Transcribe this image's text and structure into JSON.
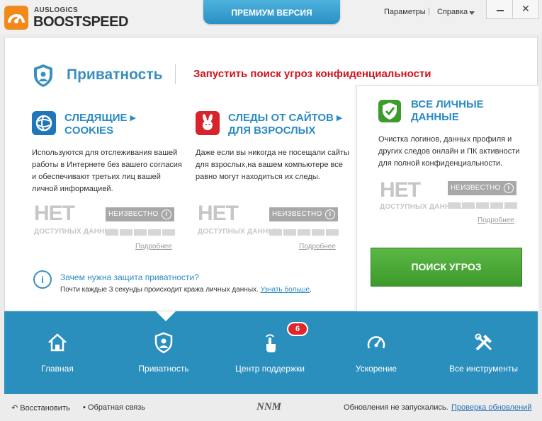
{
  "app": {
    "brand_small": "AUSLOGICS",
    "brand_big": "BOOSTSPEED",
    "premium_tab": "ПРЕМИУМ ВЕРСИЯ",
    "menu_settings": "Параметры",
    "menu_separator": "|",
    "menu_help": "Справка",
    "close_symbol": "✕"
  },
  "header": {
    "title": "Приватность",
    "threat_link": "Запустить поиск угроз конфиденциальности"
  },
  "cards": [
    {
      "title_line1": "СЛЕДЯЩИЕ",
      "title_arrow": "▸",
      "title_line2": "COOKIES",
      "description": "Используются для отслеживания вашей работы в Интернете без вашего согласия и обеспечивают третьих лиц вашей личной информацией.",
      "status_big": "НЕТ",
      "status_sub": "ДОСТУПНЫХ ДАННЫХ",
      "level_label": "НЕИЗВЕСТНО",
      "info_symbol": "i",
      "more_link": "Подробнее",
      "icon": "globe-icon",
      "icon_color": "#1f76b8"
    },
    {
      "title_line1": "СЛЕДЫ ОТ САЙТОВ",
      "title_arrow": "▸",
      "title_line2": "ДЛЯ ВЗРОСЛЫХ",
      "description": "Даже если вы никогда не посещали сайты для взрослых,на вашем компьютере все равно могут находиться их следы.",
      "status_big": "НЕТ",
      "status_sub": "ДОСТУПНЫХ ДАННЫХ",
      "level_label": "НЕИЗВЕСТНО",
      "info_symbol": "i",
      "more_link": "Подробнее",
      "icon": "bunny-icon",
      "icon_color": "#d7232a"
    }
  ],
  "right_card": {
    "title_line1": "ВСЕ ЛИЧНЫЕ",
    "title_line2": "ДАННЫЕ",
    "description": "Очистка логинов, данных профиля и других следов онлайн и ПК активности для полной конфиденциальности.",
    "status_big": "НЕТ",
    "status_sub": "ДОСТУПНЫХ ДАННЫХ",
    "level_label": "НЕИЗВЕСТНО",
    "info_symbol": "i",
    "more_link": "Подробнее",
    "scan_button": "ПОИСК УГРОЗ",
    "icon": "shield-check-icon",
    "icon_color": "#3d9a2c"
  },
  "why": {
    "icon_symbol": "i",
    "title": "Зачем нужна защита приватности?",
    "text": "Почти каждые 3 секунды происходит кража личных данных.",
    "link": "Узнать больше",
    "period": "."
  },
  "nav": {
    "items": [
      {
        "label": "Главная",
        "icon": "home-icon"
      },
      {
        "label": "Приватность",
        "icon": "privacy-shield-icon"
      },
      {
        "label": "Центр поддержки",
        "icon": "touch-hand-icon"
      },
      {
        "label": "Ускорение",
        "icon": "speedometer-icon"
      },
      {
        "label": "Все инструменты",
        "icon": "tools-icon"
      }
    ],
    "badge_count": "6",
    "active_index": 1
  },
  "status_bar": {
    "restore": "Восстановить",
    "feedback": "Обратная связь",
    "watermark": "NNM",
    "updates": "Обновления не запускались.",
    "check_updates": "Проверка обновлений"
  },
  "colors": {
    "accent": "#2b8fbe",
    "title_blue": "#3b8fbf",
    "threat_red": "#d0141c",
    "scan_green": "#4aa83a",
    "badge_red": "#e0262b"
  }
}
